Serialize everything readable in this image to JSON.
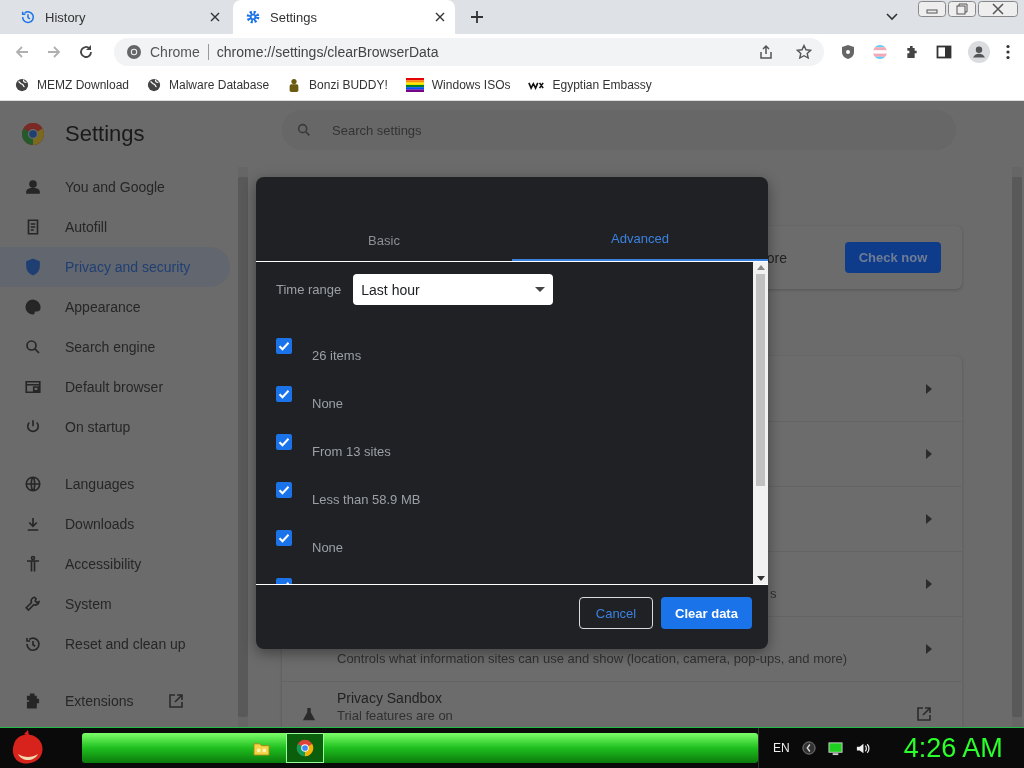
{
  "browser": {
    "tabs": [
      {
        "label": "History",
        "selected": false
      },
      {
        "label": "Settings",
        "selected": true
      }
    ],
    "omnibox": {
      "site": "Chrome",
      "url": "chrome://settings/clearBrowserData"
    },
    "bookmarks": [
      {
        "label": "MEMZ Download",
        "kind": "globe"
      },
      {
        "label": "Malware Database",
        "kind": "globe"
      },
      {
        "label": "Bonzi BUDDY!",
        "kind": "figure"
      },
      {
        "label": "Windows ISOs",
        "kind": "stripes"
      },
      {
        "label": "Egyptian Embassy",
        "kind": "wix"
      }
    ]
  },
  "settings": {
    "title": "Settings",
    "search": {
      "placeholder": "Search settings"
    },
    "sidebar": [
      {
        "items": [
          {
            "label": "You and Google",
            "selected": false
          },
          {
            "label": "Autofill",
            "selected": false
          },
          {
            "label": "Privacy and security",
            "selected": true
          },
          {
            "label": "Appearance",
            "selected": false
          },
          {
            "label": "Search engine",
            "selected": false
          },
          {
            "label": "Default browser",
            "selected": false
          },
          {
            "label": "On startup",
            "selected": false
          }
        ]
      },
      {
        "items": [
          {
            "label": "Languages",
            "selected": false
          },
          {
            "label": "Downloads",
            "selected": false
          },
          {
            "label": "Accessibility",
            "selected": false
          },
          {
            "label": "System",
            "selected": false
          },
          {
            "label": "Reset and clean up",
            "selected": false
          }
        ]
      },
      {
        "items": [
          {
            "label": "Extensions",
            "selected": false
          }
        ]
      }
    ],
    "safety_card": {
      "text": "ore",
      "button": "Check now"
    },
    "rows": [
      {
        "kind": "arrow"
      },
      {
        "kind": "arrow"
      },
      {
        "kind": "arrow"
      },
      {
        "kind": "arrow",
        "subtitle": "s",
        "behind_dialog": true
      },
      {
        "kind": "arrow",
        "subtitle": "Controls what information sites can use and show (location, camera, pop-ups, and more)",
        "behind_dialog": false
      },
      {
        "kind": "external",
        "title": "Privacy Sandbox",
        "subtitle": "Trial features are on"
      }
    ]
  },
  "dialog": {
    "tabs": [
      {
        "label": "Basic",
        "selected": false
      },
      {
        "label": "Advanced",
        "selected": true
      }
    ],
    "time_range": {
      "label": "Time range",
      "value": "Last hour"
    },
    "items": [
      {
        "detail": "26 items",
        "checked": true
      },
      {
        "detail": "None",
        "checked": true
      },
      {
        "detail": "From 13 sites",
        "checked": true
      },
      {
        "detail": "Less than 58.9 MB",
        "checked": true
      },
      {
        "detail": "None",
        "checked": true
      },
      {
        "checked": true
      }
    ],
    "buttons": {
      "cancel": "Cancel",
      "confirm": "Clear data"
    }
  },
  "taskbar": {
    "tasks": [
      {
        "kind": "folder",
        "active": false
      },
      {
        "kind": "browser",
        "active": true
      }
    ],
    "language": "EN",
    "clock": "4:26 AM"
  }
}
